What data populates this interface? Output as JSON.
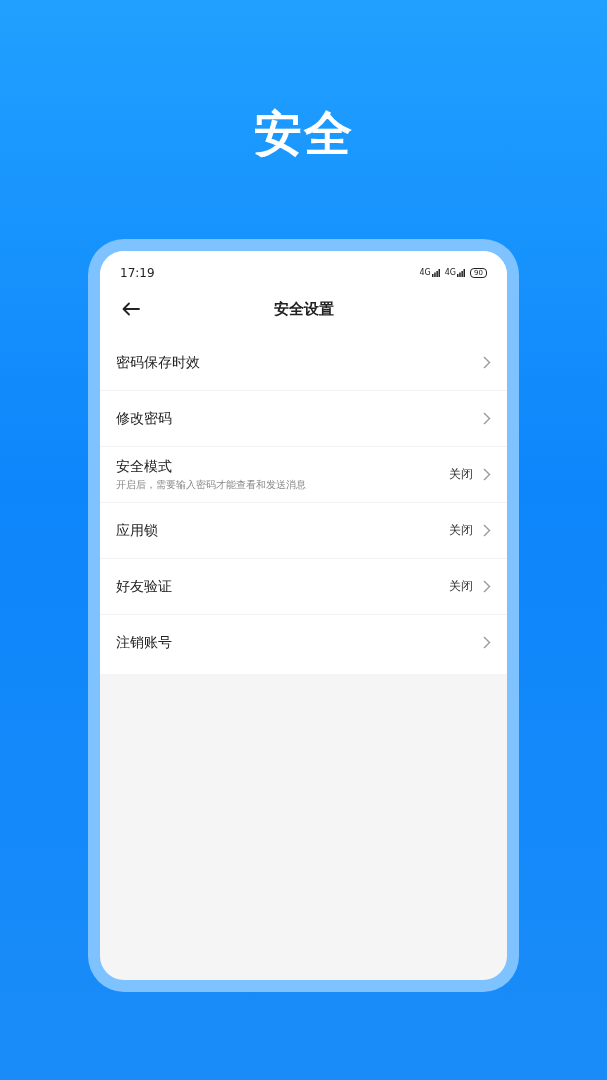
{
  "headline": "安全",
  "status_bar": {
    "time": "17:19",
    "signals": [
      {
        "network": "4G"
      },
      {
        "network": "4G"
      }
    ],
    "battery": "90"
  },
  "nav": {
    "title": "安全设置"
  },
  "settings": [
    {
      "label": "密码保存时效"
    },
    {
      "label": "修改密码"
    },
    {
      "label": "安全模式",
      "description": "开启后，需要输入密码才能查看和发送消息",
      "value": "关闭"
    },
    {
      "label": "应用锁",
      "value": "关闭"
    },
    {
      "label": "好友验证",
      "value": "关闭"
    },
    {
      "label": "注销账号"
    }
  ]
}
